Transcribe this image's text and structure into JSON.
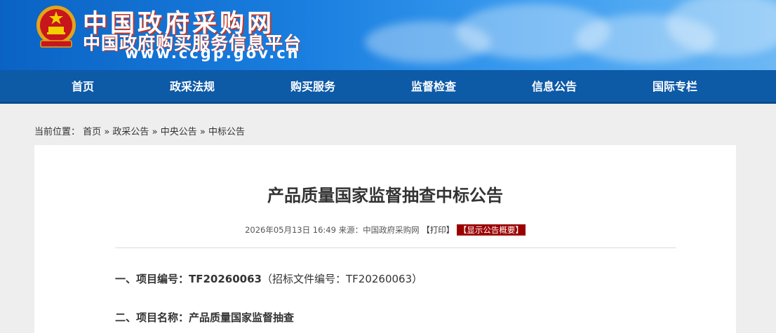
{
  "header": {
    "title": "中国政府采购网",
    "subtitle": "中国政府购买服务信息平台",
    "url": "www.ccgp.gov.cn"
  },
  "nav": {
    "items": [
      "首页",
      "政采法规",
      "购买服务",
      "监督检查",
      "信息公告",
      "国际专栏"
    ]
  },
  "breadcrumb": {
    "prefix": "当前位置：",
    "items": [
      "首页",
      "政采公告",
      "中央公告",
      "中标公告"
    ],
    "separator": "»"
  },
  "article": {
    "title": "产品质量国家监督抽查中标公告",
    "date": "2026年05月13日 16:49",
    "source_label": "来源：",
    "source": "中国政府采购网",
    "print_label": "【打印】",
    "summary_label": "【显示公告概要】",
    "line1_heading": "一、项目编号：",
    "line1_value": "TF20260063",
    "line1_extra": "（招标文件编号：TF20260063）",
    "line2_heading": "二、项目名称：",
    "line2_value": "产品质量国家监督抽查"
  },
  "colors": {
    "header_blue": "#0a63c4",
    "nav_blue": "#0d5aa7",
    "summary_red": "#9b0000"
  }
}
